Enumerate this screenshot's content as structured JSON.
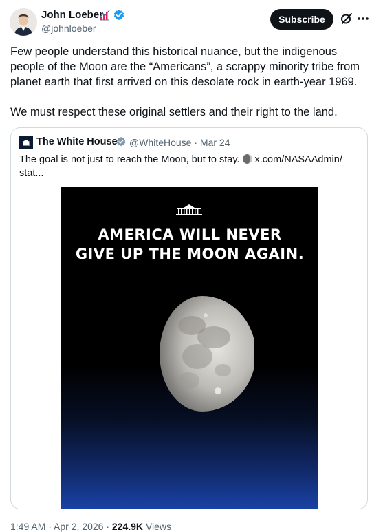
{
  "author": {
    "name": "John Loeber",
    "handle": "@johnloeber",
    "avatar_icon": "avatar-photo-icon",
    "badge_icon": "rising-bars-emoji-icon",
    "verified_icon": "verified-check-icon",
    "verified_color": "#1d9bf0"
  },
  "actions": {
    "subscribe_label": "Subscribe",
    "grok_icon": "grok-icon",
    "more_icon": "more-dots-icon"
  },
  "tweet": {
    "paragraph_1": "Few people understand this historical nuance, but the indigenous people of the Moon are the “Americans”, a scrappy minority tribe from planet earth that first arrived on this desolate rock in earth-year 1969.",
    "paragraph_2": "We must respect these original settlers and their right to the land."
  },
  "quote": {
    "name": "The White House",
    "handle": "@WhiteHouse",
    "separator": " · ",
    "date": "Mar 24",
    "text_before": "The goal is not just to reach the Moon, but to stay.",
    "moon_icon": "moon-emoji-icon",
    "link": "x.com/NASAAdmin/",
    "link_cont": "stat...",
    "poster": {
      "logo_icon": "white-house-logo-icon",
      "headline_line_1": "AMERICA WILL NEVER",
      "headline_line_2": "GIVE UP THE MOON AGAIN."
    }
  },
  "footer": {
    "time": "1:49 AM",
    "separator": " · ",
    "date": "Apr 2, 2026",
    "views_count": "224.9K",
    "views_label": "Views"
  }
}
